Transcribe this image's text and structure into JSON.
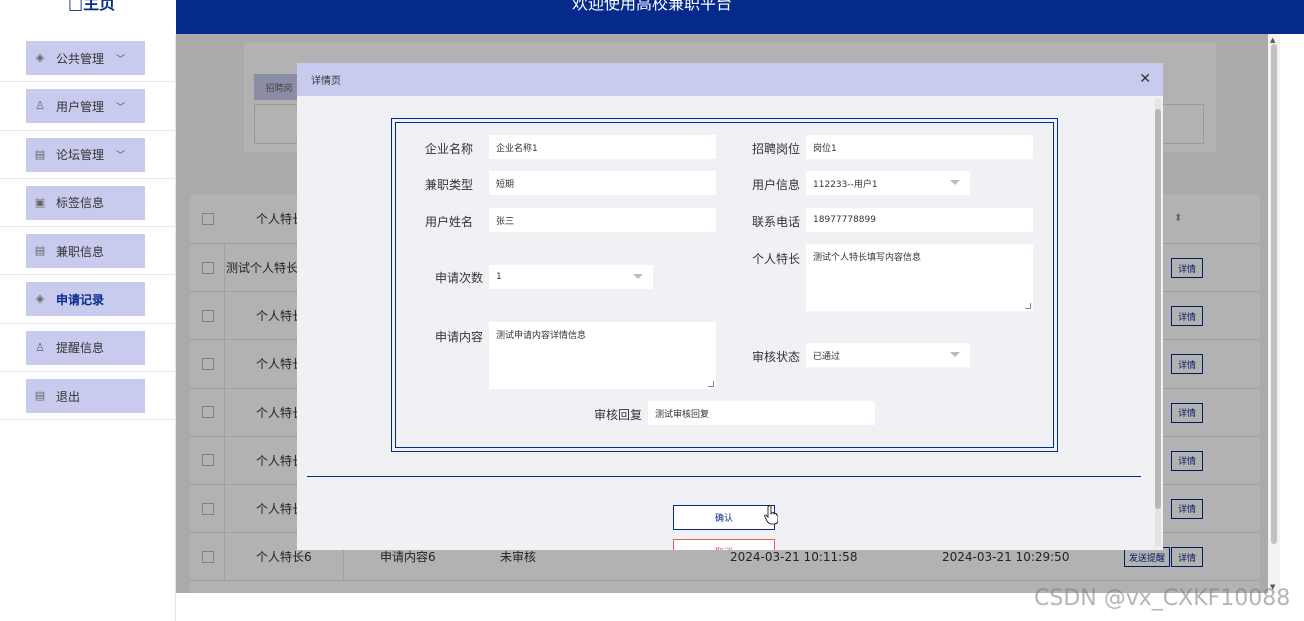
{
  "header": {
    "logo": "□主页",
    "title": "欢迎使用高校兼职平台"
  },
  "sidebar": {
    "items": [
      {
        "label": "公共管理",
        "icon": "layers-icon",
        "expandable": true
      },
      {
        "label": "用户管理",
        "icon": "user-icon",
        "expandable": true
      },
      {
        "label": "论坛管理",
        "icon": "list-icon",
        "expandable": true
      },
      {
        "label": "标签信息",
        "icon": "clipboard-icon",
        "expandable": false
      },
      {
        "label": "兼职信息",
        "icon": "list-icon",
        "expandable": false
      },
      {
        "label": "申请记录",
        "icon": "layers-icon",
        "expandable": false,
        "active": true
      },
      {
        "label": "提醒信息",
        "icon": "user-icon",
        "expandable": false
      },
      {
        "label": "退出",
        "icon": "list-icon",
        "expandable": false
      }
    ]
  },
  "background": {
    "search_btn": "招聘岗",
    "table": {
      "header": "个人特长",
      "rows": [
        {
          "c1": "测试个人特长填",
          "status": "",
          "t1": "",
          "t2": ""
        },
        {
          "c1": "个人特长",
          "status": "",
          "t1": "",
          "t2": ""
        },
        {
          "c1": "个人特长",
          "status": "",
          "t1": "",
          "t2": ""
        },
        {
          "c1": "个人特长",
          "status": "",
          "t1": "",
          "t2": ""
        },
        {
          "c1": "个人特长",
          "status": "",
          "t1": "",
          "t2": ""
        },
        {
          "c1": "个人特长",
          "status": "",
          "t1": "",
          "t2": ""
        },
        {
          "c1": "个人特长6",
          "c2": "申请内容6",
          "status": "未审核",
          "t1": "2024-03-21 10:11:58",
          "t2": "2024-03-21 10:29:50",
          "remind": "发送提醒"
        }
      ],
      "detail_label": "详情"
    }
  },
  "modal": {
    "title": "详情页",
    "fields": {
      "company_label": "企业名称",
      "company_value": "企业名称1",
      "post_label": "招聘岗位",
      "post_value": "岗位1",
      "type_label": "兼职类型",
      "type_value": "短期",
      "userinfo_label": "用户信息",
      "userinfo_value": "112233--用户1",
      "name_label": "用户姓名",
      "name_value": "张三",
      "phone_label": "联系电话",
      "phone_value": "18977778899",
      "count_label": "申请次数",
      "count_value": "1",
      "skill_label": "个人特长",
      "skill_value": "测试个人特长填写内容信息",
      "content_label": "申请内容",
      "content_value": "测试申请内容详情信息",
      "audit_label": "审核状态",
      "audit_value": "已通过",
      "reply_label": "审核回复",
      "reply_value": "测试审核回复"
    },
    "confirm": "确认",
    "cancel": "取消"
  },
  "watermark": "CSDN @vx_CXKF10088"
}
